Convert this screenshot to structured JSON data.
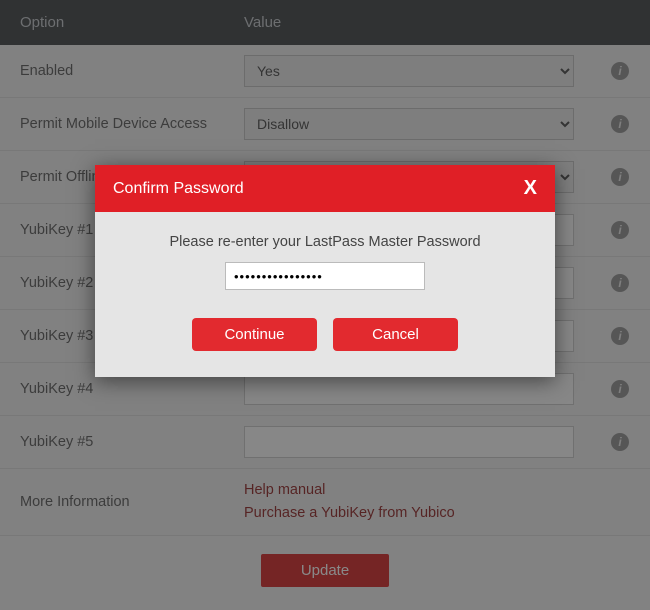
{
  "header": {
    "option": "Option",
    "value": "Value"
  },
  "rows": {
    "enabled": {
      "label": "Enabled",
      "selected": "Yes"
    },
    "permit_mobile": {
      "label": "Permit Mobile Device Access",
      "selected": "Disallow"
    },
    "permit_offline": {
      "label": "Permit Offline Access",
      "selected": ""
    },
    "yk1": {
      "label": "YubiKey #1",
      "value": ""
    },
    "yk2": {
      "label": "YubiKey #2",
      "value": ""
    },
    "yk3": {
      "label": "YubiKey #3",
      "value": ""
    },
    "yk4": {
      "label": "YubiKey #4",
      "value": ""
    },
    "yk5": {
      "label": "YubiKey #5",
      "value": ""
    },
    "more_info": {
      "label": "More Information",
      "link_help": "Help manual",
      "link_purchase": "Purchase a YubiKey from Yubico"
    }
  },
  "footer": {
    "update": "Update"
  },
  "modal": {
    "title": "Confirm Password",
    "close_glyph": "X",
    "prompt": "Please re-enter your LastPass Master Password",
    "password_value": "••••••••••••••••",
    "continue": "Continue",
    "cancel": "Cancel"
  },
  "info_glyph": "i"
}
